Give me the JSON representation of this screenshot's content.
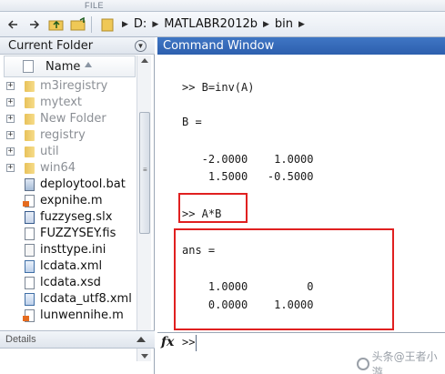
{
  "ribbon": {
    "label": "FILE"
  },
  "address_bar": {
    "path": [
      "D:",
      "MATLABR2012b",
      "bin"
    ]
  },
  "current_folder": {
    "title": "Current Folder",
    "column_name": "Name",
    "items": [
      {
        "name": "m3iregistry",
        "type": "folder",
        "dim": true
      },
      {
        "name": "mytext",
        "type": "folder",
        "dim": true
      },
      {
        "name": "New Folder",
        "type": "folder",
        "dim": true
      },
      {
        "name": "registry",
        "type": "folder",
        "dim": true
      },
      {
        "name": "util",
        "type": "folder",
        "dim": true
      },
      {
        "name": "win64",
        "type": "folder",
        "dim": true
      },
      {
        "name": "deploytool.bat",
        "type": "bat"
      },
      {
        "name": "expnihe.m",
        "type": "m"
      },
      {
        "name": "fuzzyseg.slx",
        "type": "slx"
      },
      {
        "name": "FUZZYSEY.fis",
        "type": "fis"
      },
      {
        "name": "insttype.ini",
        "type": "ini"
      },
      {
        "name": "lcdata.xml",
        "type": "xml"
      },
      {
        "name": "lcdata.xsd",
        "type": "xsd"
      },
      {
        "name": "lcdata_utf8.xml",
        "type": "xml"
      },
      {
        "name": "lunwennihe.m",
        "type": "m"
      }
    ],
    "details_label": "Details"
  },
  "command_window": {
    "title": "Command Window",
    "lines": [
      ">> B=inv(A)",
      "B =",
      "   -2.0000    1.0000",
      "    1.5000   -0.5000",
      ">> A*B",
      "ans =",
      "    1.0000         0",
      "    0.0000    1.0000"
    ],
    "prompt": ">>"
  },
  "watermark": {
    "text": "头条@王者小游"
  },
  "colors": {
    "title_bar": "#2d5fae",
    "highlight": "#e02020"
  }
}
